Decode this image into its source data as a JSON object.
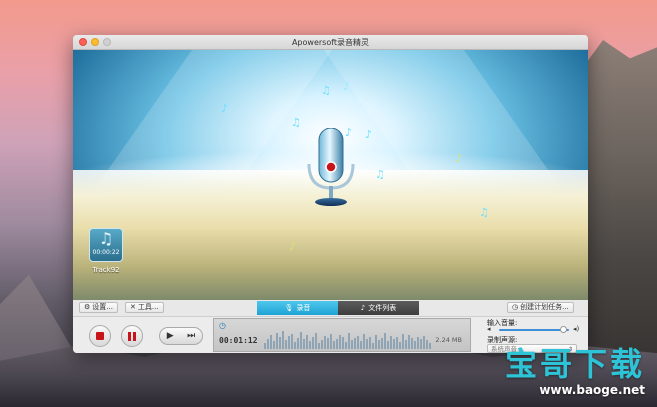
{
  "window": {
    "title": "Apowersoft录音精灵"
  },
  "artwork": {
    "track_time": "00:00:22",
    "track_name": "Track92"
  },
  "toolbar": {
    "settings_label": "设置...",
    "tools_label": "工具...",
    "tab_record": "录音",
    "tab_files": "文件列表",
    "schedule_label": "创建计划任务..."
  },
  "player": {
    "elapsed": "00:01:12",
    "size": "2.24 MB"
  },
  "audio": {
    "input_volume_label": "输入音量:",
    "input_volume_level": 0.92,
    "record_source_label": "录制声源:",
    "record_source_value": "系统声音"
  },
  "watermark": {
    "brand": "宝哥下载",
    "url": "www.baoge.net"
  },
  "colors": {
    "accent": "#1ea3d4",
    "record_red": "#c8141b",
    "watermark": "#2ec4d8"
  }
}
